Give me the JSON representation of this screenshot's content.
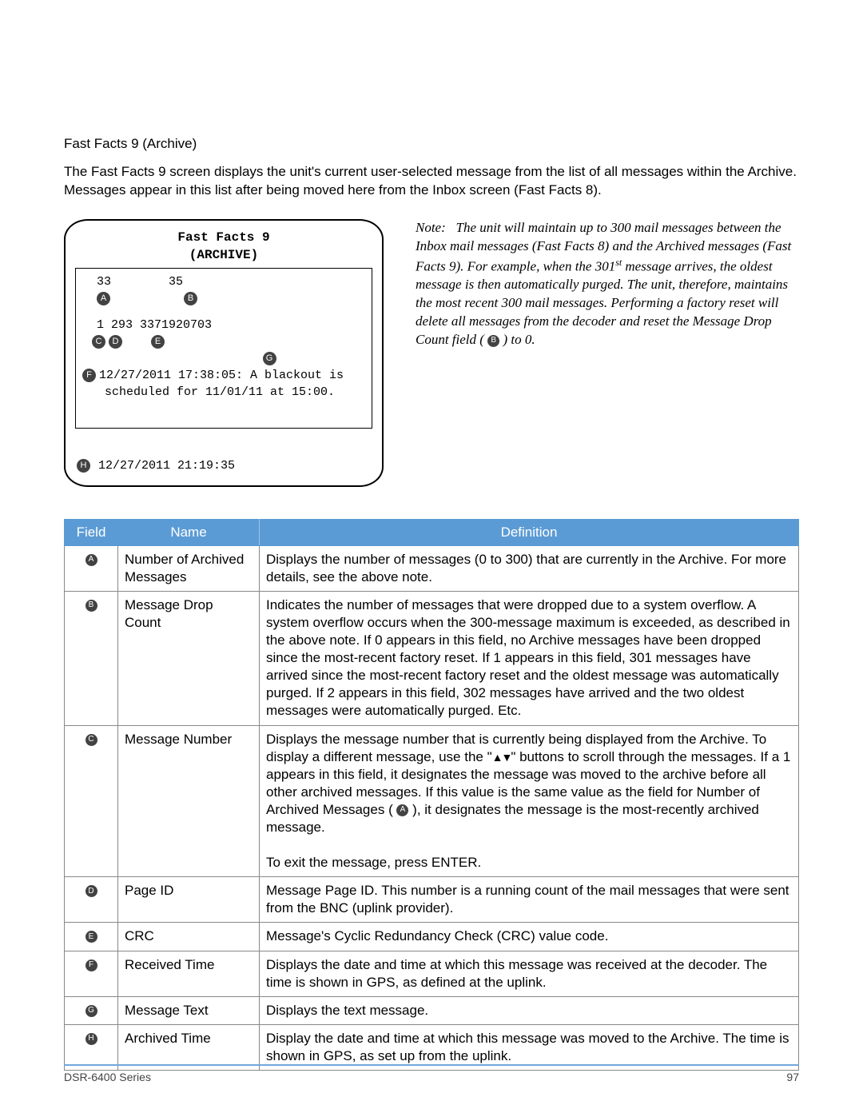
{
  "heading": "Fast Facts 9 (Archive)",
  "intro": "The Fast Facts 9 screen displays the unit's current user-selected message from the list of all messages within the Archive. Messages appear in this list after being moved here from the Inbox screen (Fast Facts 8).",
  "screen": {
    "title1": "Fast Facts 9",
    "title2": "(ARCHIVE)",
    "line1_a": "33",
    "line1_b": "35",
    "line2": "1 293 3371920703",
    "msg_line1": "12/27/2011 17:38:05: A blackout is",
    "msg_line2": "scheduled for 11/01/11 at 15:00.",
    "archived": "12/27/2011 21:19:35"
  },
  "bullets": {
    "A": "A",
    "B": "B",
    "C": "C",
    "D": "D",
    "E": "E",
    "F": "F",
    "G": "G",
    "H": "H"
  },
  "note_label": "Note:",
  "note_before": "The unit will maintain up to 300 mail messages between the Inbox mail messages (Fast Facts 8) and the Archived messages (Fast Facts 9). For example, when the 301",
  "note_sup": "st",
  "note_after_sup": " message arrives, the oldest message is then automatically purged. The unit, therefore, maintains the most recent 300 mail messages. Performing a factory reset will delete all messages from the decoder and reset the Message Drop Count field ( ",
  "note_after_bullet": " ) to 0.",
  "table": {
    "headers": {
      "field": "Field",
      "name": "Name",
      "definition": "Definition"
    },
    "rows": [
      {
        "bullet": "A",
        "name": "Number of Archived Messages",
        "def": "Displays the number of messages (0 to 300) that are currently in the Archive. For more details, see the above note."
      },
      {
        "bullet": "B",
        "name": "Message Drop Count",
        "def": "Indicates the number of messages that were dropped due to a system overflow. A system overflow occurs when the 300-message maximum is exceeded, as described in the above note. If 0 appears in this field, no Archive messages have been dropped since the most-recent factory reset. If 1 appears in this field, 301 messages have arrived since the most-recent factory reset and the oldest message was automatically purged. If 2 appears in this field, 302 messages have arrived and the two oldest messages were automatically purged. Etc."
      },
      {
        "bullet": "C",
        "name": "Message Number",
        "def_before": "Displays the message number that is currently being displayed from the Archive. To display a different message, use the \"",
        "def_mid": "\" buttons to scroll through the messages. If a 1 appears in this field, it designates the message was moved to the archive before all other archived messages. If this value is the same value as the field for Number of Archived Messages ( ",
        "def_after_bullet": " ), it designates the message is the most-recently archived message.",
        "def_tail": "To exit the message, press ENTER."
      },
      {
        "bullet": "D",
        "name": "Page ID",
        "def": "Message Page ID. This number is a running count of the mail messages that were sent from the BNC (uplink provider)."
      },
      {
        "bullet": "E",
        "name": "CRC",
        "def": "Message's Cyclic Redundancy Check (CRC) value code."
      },
      {
        "bullet": "F",
        "name": "Received Time",
        "def": "Displays the date and time at which this message was received at the decoder. The time is shown in GPS, as defined at the uplink."
      },
      {
        "bullet": "G",
        "name": "Message Text",
        "def": "Displays the text message."
      },
      {
        "bullet": "H",
        "name": "Archived Time",
        "def": "Display the date and time at which this message was moved to the Archive. The time is shown in GPS, as set up from the uplink."
      }
    ]
  },
  "footer": {
    "left": "DSR-6400 Series",
    "right": "97"
  },
  "icons": {
    "updown": "▲▼"
  }
}
